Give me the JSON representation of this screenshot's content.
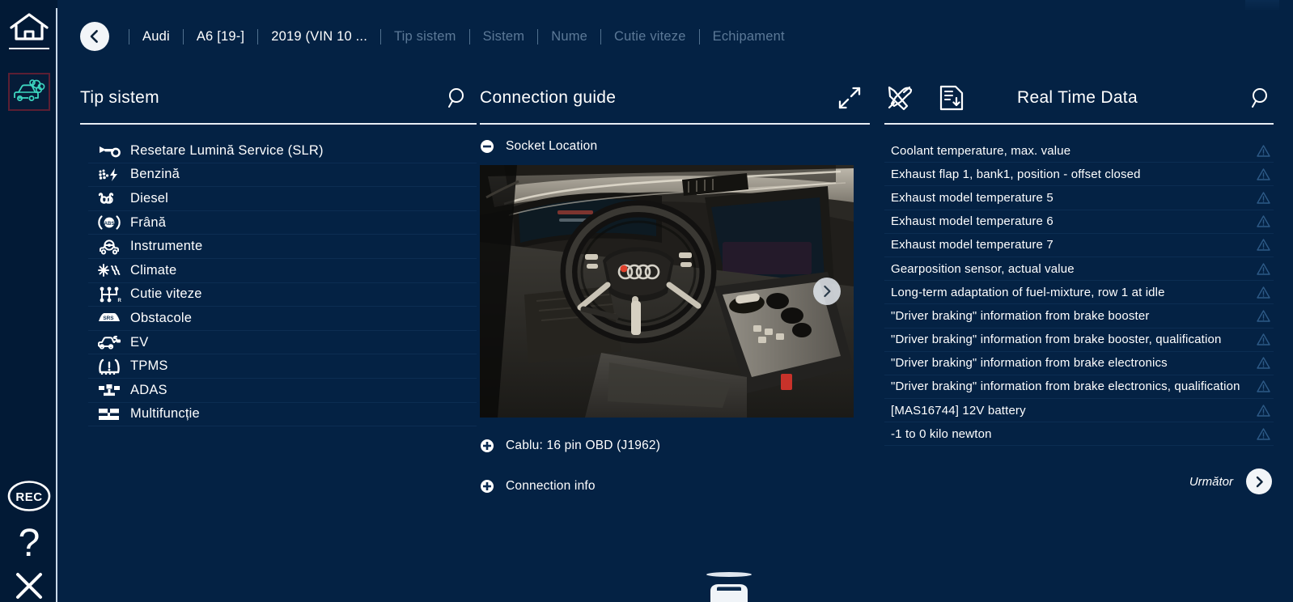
{
  "rail": {
    "home": "home-icon",
    "vehicle_emissions": "vehicle-exhaust-icon",
    "rec": "REC",
    "help": "?",
    "close": "close-icon"
  },
  "breadcrumb": {
    "back_label": "back-chevron",
    "items": [
      {
        "label": "Audi",
        "dim": false
      },
      {
        "label": "A6 [19-]",
        "dim": false
      },
      {
        "label": "2019 (VIN 10 ...",
        "dim": false
      },
      {
        "label": "Tip sistem",
        "dim": true
      },
      {
        "label": "Sistem",
        "dim": true
      },
      {
        "label": "Nume",
        "dim": true
      },
      {
        "label": "Cutie viteze",
        "dim": true
      },
      {
        "label": "Echipament",
        "dim": true
      }
    ]
  },
  "system_panel": {
    "title": "Tip sistem",
    "search_icon": "search-icon",
    "items": [
      {
        "label": "Resetare Lumină Service (SLR)",
        "icon": "wrench-icon"
      },
      {
        "label": "Benzină",
        "icon": "petrol-engine-icon"
      },
      {
        "label": "Diesel",
        "icon": "diesel-glowplug-icon"
      },
      {
        "label": "Frână",
        "icon": "abs-brake-icon"
      },
      {
        "label": "Instrumente",
        "icon": "instrument-cluster-icon"
      },
      {
        "label": "Climate",
        "icon": "climate-icon"
      },
      {
        "label": "Cutie viteze",
        "icon": "gearbox-icon"
      },
      {
        "label": "Obstacole",
        "icon": "srs-airbag-icon"
      },
      {
        "label": "EV",
        "icon": "electric-vehicle-icon"
      },
      {
        "label": "TPMS",
        "icon": "tire-pressure-icon"
      },
      {
        "label": "ADAS",
        "icon": "adas-icon"
      },
      {
        "label": "Multifuncție",
        "icon": "multifunction-icon"
      }
    ]
  },
  "connection_panel": {
    "title": "Connection guide",
    "expand_icon": "expand-arrows-icon",
    "socket_section": {
      "label": "Socket Location",
      "toggle_icon": "minus-circle-icon",
      "expanded": true
    },
    "photo_alt": "Audi A6 interior dashboard",
    "carousel_next_icon": "chevron-right-icon",
    "links": [
      {
        "label": "Cablu: 16 pin OBD (J1962)",
        "icon": "plus-circle-icon"
      },
      {
        "label": "Connection info",
        "icon": "plus-circle-icon"
      }
    ]
  },
  "realtime_panel": {
    "title": "Real Time Data",
    "tools_icon": "tools-icon",
    "report_icon": "save-report-icon",
    "search_icon": "search-icon",
    "warn_icon": "warning-triangle-icon",
    "rows": [
      "Coolant temperature, max. value",
      "Exhaust flap 1, bank1, position - offset closed",
      "Exhaust model temperature 5",
      "Exhaust model temperature 6",
      "Exhaust model temperature 7",
      "Gearposition sensor, actual value",
      "Long-term adaptation of fuel-mixture, row 1 at idle",
      "\"Driver braking\" information from brake booster",
      "\"Driver braking\" information from brake booster, qualification",
      "\"Driver braking\" information from brake electronics",
      "\"Driver braking\" information from brake electronics, qualification",
      "[MAS16744] 12V battery",
      "-1 to 0 kilo newton"
    ],
    "footer": {
      "next_label": "Următor",
      "next_icon": "chevron-right-icon"
    }
  },
  "bottom": {
    "car_icon": "car-icon"
  },
  "colors": {
    "background": "#042244",
    "rail": "#021a36",
    "accent_teal": "#3dd6c0",
    "accent_red": "#5c1f33",
    "text": "#ffffff",
    "text_dim": "#5c7997",
    "rule": "#e8eef4"
  }
}
